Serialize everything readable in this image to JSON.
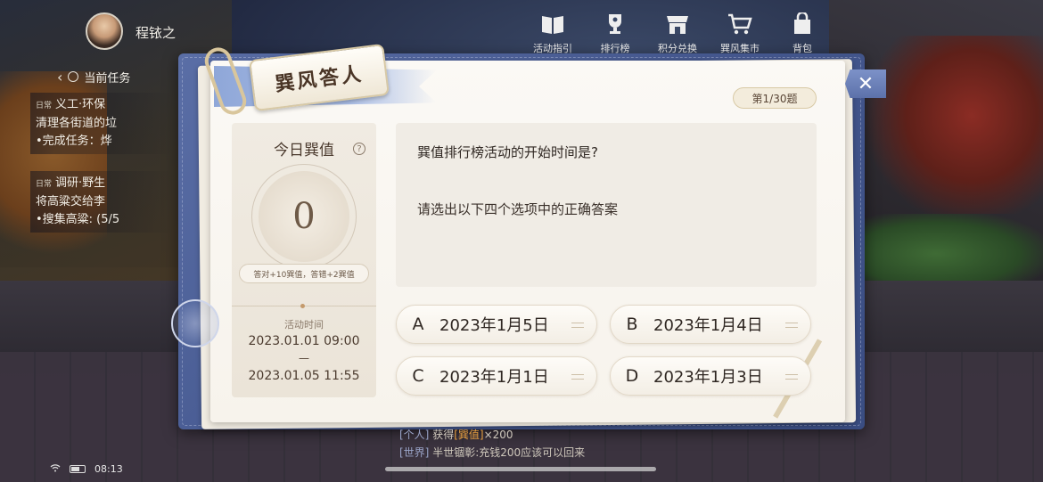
{
  "player": {
    "name": "程铱之"
  },
  "tasks": {
    "header": "当前任务",
    "items": [
      {
        "tag": "日常",
        "title": "义工·环保",
        "desc1": "清理各街道的垃",
        "desc2": "•完成任务：烨"
      },
      {
        "tag": "日常",
        "title": "调研·野生",
        "desc1": "将高粱交给李",
        "desc2": "•搜集高粱: (5/5"
      }
    ]
  },
  "top_nav": [
    {
      "label": "活动指引",
      "icon": "book-icon"
    },
    {
      "label": "排行榜",
      "icon": "trophy-icon"
    },
    {
      "label": "积分兑换",
      "icon": "shop-icon"
    },
    {
      "label": "巽风集市",
      "icon": "cart-icon"
    },
    {
      "label": "背包",
      "icon": "bag-icon"
    }
  ],
  "modal": {
    "title": "巽风答人",
    "close_label": "✕",
    "counter": "第1/30题",
    "score_title": "今日巽值",
    "score_value": "0",
    "help": "?",
    "rule": "答对+10巽值，答错+2巽值",
    "time_label": "活动时间",
    "time_start": "2023.01.01 09:00",
    "time_sep": "—",
    "time_end": "2023.01.05 11:55",
    "question": "巽值排行榜活动的开始时间是?",
    "hint": "请选出以下四个选项中的正确答案",
    "options": [
      {
        "letter": "A",
        "text": "2023年1月5日"
      },
      {
        "letter": "B",
        "text": "2023年1月4日"
      },
      {
        "letter": "C",
        "text": "2023年1月1日"
      },
      {
        "letter": "D",
        "text": "2023年1月3日"
      }
    ]
  },
  "chat": {
    "line1_channel": "[个人]",
    "line1_pre": " 获得",
    "line1_item": "[巽值]",
    "line1_post": "×200",
    "line2_channel": "[世界]",
    "line2_text": " 半世锢彰:充钱200应该可以回来"
  },
  "status": {
    "time": "08:13"
  },
  "colors": {
    "frame": "#4a5d96",
    "paper": "#fbf9f5",
    "accent": "#c49a6c"
  }
}
